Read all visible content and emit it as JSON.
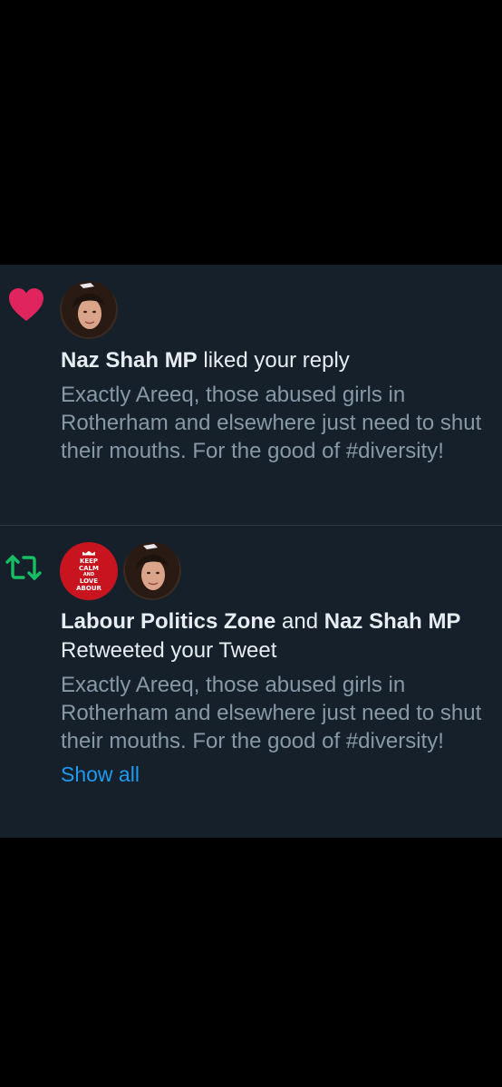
{
  "colors": {
    "background": "#000000",
    "feed_background": "#15202b",
    "heart": "#e0245e",
    "retweet": "#17bf63",
    "primary_text": "#e7ecf0",
    "secondary_text": "#8899a6",
    "link": "#1d9bf0"
  },
  "notifications": [
    {
      "type": "like",
      "icon": "heart-icon",
      "avatars": [
        "naz-shah-avatar"
      ],
      "headline": {
        "name": "Naz Shah MP",
        "action": " liked your reply"
      },
      "tweet_text": "Exactly Areeq, those abused girls in Rotherham and elsewhere just need to shut their mouths. For the good of #diversity!"
    },
    {
      "type": "retweet",
      "icon": "retweet-icon",
      "avatars": [
        "labour-politics-zone-avatar",
        "naz-shah-avatar"
      ],
      "keep_calm_badge": {
        "line1": "KEEP",
        "line2": "CALM",
        "line3": "AND",
        "line4": "LOVE",
        "line5": "ABOUR"
      },
      "headline": {
        "name1": "Labour Politics Zone",
        "joiner": " and ",
        "name2": "Naz Shah MP",
        "action": " Retweeted your Tweet"
      },
      "tweet_text": "Exactly Areeq, those abused girls in Rotherham and elsewhere just need to shut their mouths. For the good of #diversity!",
      "show_all": "Show all"
    }
  ]
}
